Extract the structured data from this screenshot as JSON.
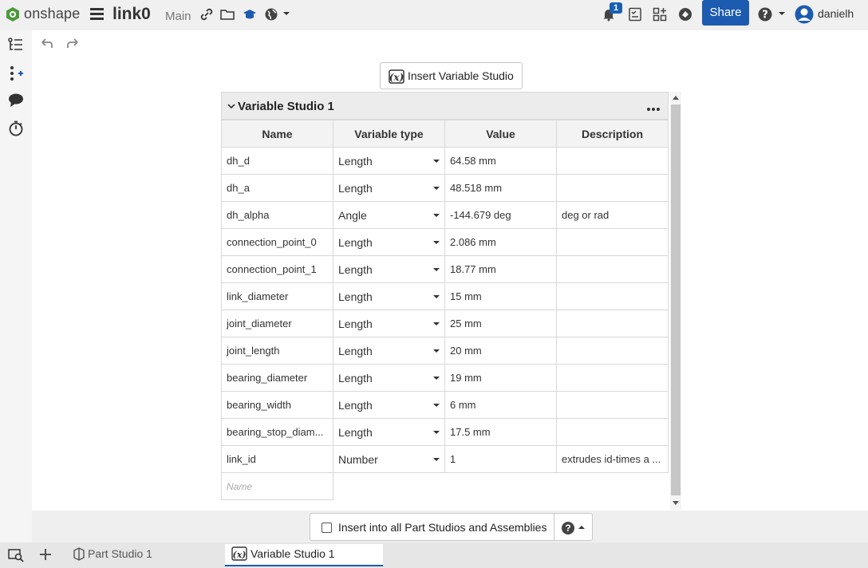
{
  "app": {
    "brand": "onshape",
    "document_title": "link0",
    "branch": "Main",
    "notification_count": "1",
    "share_label": "Share",
    "user_name": "danielh"
  },
  "toolbar": {
    "insert_variable_studio_label": "Insert Variable Studio"
  },
  "variable_studio": {
    "title": "Variable Studio 1",
    "columns": [
      "Name",
      "Variable type",
      "Value",
      "Description"
    ],
    "rows": [
      {
        "name": "dh_d",
        "type": "Length",
        "value": "64.58 mm",
        "description": ""
      },
      {
        "name": "dh_a",
        "type": "Length",
        "value": "48.518 mm",
        "description": ""
      },
      {
        "name": "dh_alpha",
        "type": "Angle",
        "value": "-144.679 deg",
        "description": "deg or rad"
      },
      {
        "name": "connection_point_0",
        "type": "Length",
        "value": "2.086 mm",
        "description": ""
      },
      {
        "name": "connection_point_1",
        "type": "Length",
        "value": "18.77 mm",
        "description": ""
      },
      {
        "name": "link_diameter",
        "type": "Length",
        "value": "15 mm",
        "description": ""
      },
      {
        "name": "joint_diameter",
        "type": "Length",
        "value": "25 mm",
        "description": ""
      },
      {
        "name": "joint_length",
        "type": "Length",
        "value": "20 mm",
        "description": ""
      },
      {
        "name": "bearing_diameter",
        "type": "Length",
        "value": "19 mm",
        "description": ""
      },
      {
        "name": "bearing_width",
        "type": "Length",
        "value": "6 mm",
        "description": ""
      },
      {
        "name": "bearing_stop_diam...",
        "type": "Length",
        "value": "17.5 mm",
        "description": ""
      },
      {
        "name": "link_id",
        "type": "Number",
        "value": "1",
        "description": "extrudes id-times a ..."
      }
    ],
    "new_name_placeholder": "Name"
  },
  "footer": {
    "insert_all_label": "Insert into all Part Studios and Assemblies",
    "help_label": "?"
  },
  "tabs": [
    {
      "label": "Part Studio 1",
      "active": false
    },
    {
      "label": "Variable Studio 1",
      "active": true
    }
  ],
  "colors": {
    "accent": "#1d5bb0",
    "header_bg": "#ececec"
  }
}
